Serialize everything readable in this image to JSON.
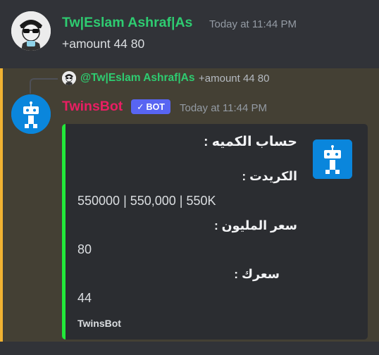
{
  "message1": {
    "username": "Tw|Eslam Ashraf|As",
    "timestamp": "Today at 11:44 PM",
    "content": "+amount 44 80"
  },
  "reply": {
    "username": "@Tw|Eslam Ashraf|As",
    "content": "+amount 44 80"
  },
  "message2": {
    "username": "TwinsBot",
    "bot_tag": "BOT",
    "timestamp": "Today at 11:44 PM"
  },
  "embed": {
    "title": "حساب الكميه :",
    "fields": [
      {
        "name": "الكريدت :",
        "value": "550000 | 550,000 | 550K"
      },
      {
        "name": "سعر المليون :",
        "value": "80"
      },
      {
        "name": "سعرك :",
        "value": "44"
      }
    ],
    "footer": "TwinsBot"
  },
  "colors": {
    "user_color": "#2ecc71",
    "bot_color": "#e91e63",
    "embed_accent": "#22e83a",
    "mention_bar": "#f0b232"
  }
}
